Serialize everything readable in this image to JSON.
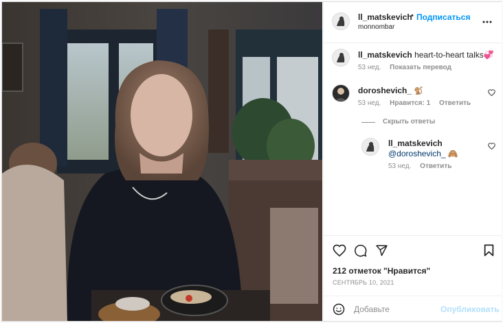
{
  "post": {
    "author": "ll_matskevich",
    "dot": "•",
    "follow_label": "Подписаться",
    "location": "monnombar",
    "more_icon": "more-horizontal-icon"
  },
  "caption": {
    "author": "ll_matskevich",
    "text": "heart-to-heart talks💞",
    "time": "53 нед.",
    "translate_label": "Показать перевод"
  },
  "comments": [
    {
      "author": "doroshevich_",
      "text": "🐒",
      "time": "53 нед.",
      "likes_label": "Нравится: 1",
      "reply_label": "Ответить"
    }
  ],
  "hide_replies_label": "Скрыть ответы",
  "reply": {
    "author": "ll_matskevich",
    "mention": "@doroshevich_",
    "text": "🙈",
    "time": "53 нед.",
    "reply_label": "Ответить"
  },
  "actions": {
    "likes_text": "212 отметок \"Нравится\"",
    "date": "СЕНТЯБРЬ 10, 2021"
  },
  "add_comment": {
    "placeholder": "Добавьте",
    "publish_label": "Опубликовать"
  },
  "colors": {
    "accent": "#0095f6",
    "publish_disabled": "#b2dffc",
    "meta": "#8e8e8e"
  }
}
